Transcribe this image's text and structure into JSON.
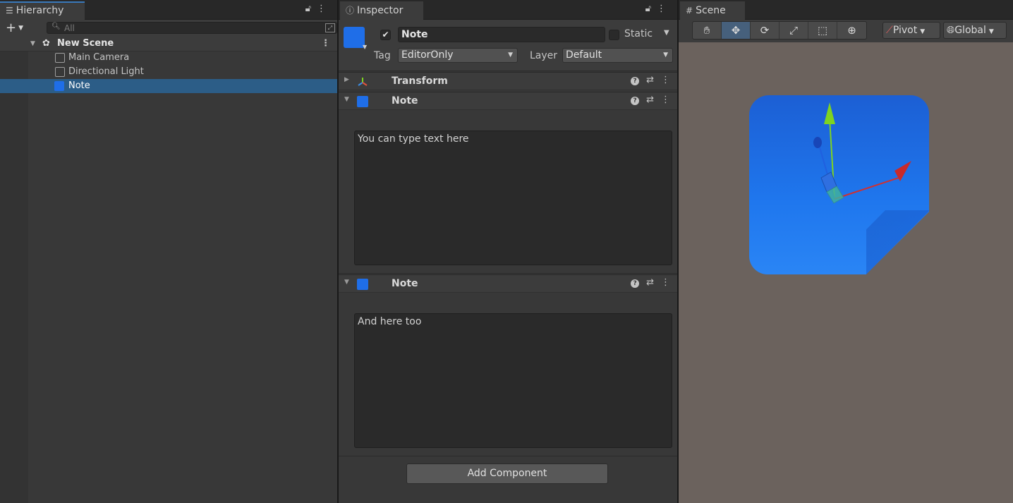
{
  "hierarchy": {
    "tab_label": "Hierarchy",
    "search_placeholder": "All",
    "scene_name": "New Scene",
    "items": [
      {
        "label": "Main Camera"
      },
      {
        "label": "Directional Light"
      },
      {
        "label": "Note"
      }
    ]
  },
  "inspector": {
    "tab_label": "Inspector",
    "object_name": "Note",
    "active": true,
    "static_label": "Static",
    "tag_label": "Tag",
    "tag_value": "EditorOnly",
    "layer_label": "Layer",
    "layer_value": "Default",
    "components": [
      {
        "title": "Transform"
      },
      {
        "title": "Note",
        "text": "You can type text here"
      },
      {
        "title": "Note",
        "text": "And here too"
      }
    ],
    "add_component_label": "Add Component"
  },
  "scene": {
    "tab_label": "Scene",
    "pivot_label": "Pivot",
    "global_label": "Global",
    "tools": [
      "hand-tool",
      "move-tool",
      "rotate-tool",
      "scale-tool",
      "rect-tool",
      "transform-tool"
    ],
    "active_tool": "move-tool"
  },
  "colors": {
    "accent": "#3a79bb",
    "selection": "#2c5d87",
    "note_blue": "#1f6ee8",
    "scene_bg": "#6b625d"
  }
}
